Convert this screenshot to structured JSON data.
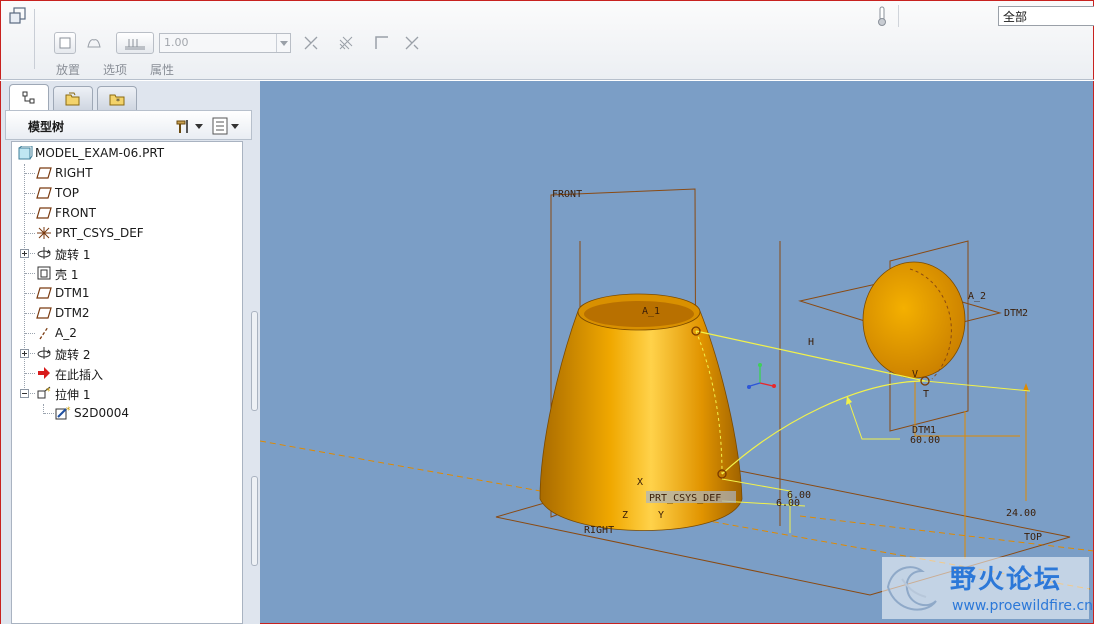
{
  "ribbon": {
    "labels": {
      "placement": "放置",
      "options": "选项",
      "properties": "属性"
    },
    "thickness_value": "1.00",
    "filter_value": "全部"
  },
  "panel": {
    "title": "模型树",
    "tree": [
      {
        "label": "MODEL_EXAM-06.PRT",
        "icon": "part-icon"
      },
      {
        "label": "RIGHT",
        "icon": "datum-plane-icon"
      },
      {
        "label": "TOP",
        "icon": "datum-plane-icon"
      },
      {
        "label": "FRONT",
        "icon": "datum-plane-icon"
      },
      {
        "label": "PRT_CSYS_DEF",
        "icon": "csys-icon"
      },
      {
        "label": "旋转 1",
        "icon": "revolve-icon"
      },
      {
        "label": "壳 1",
        "icon": "shell-icon"
      },
      {
        "label": "DTM1",
        "icon": "datum-plane-icon"
      },
      {
        "label": "DTM2",
        "icon": "datum-plane-icon"
      },
      {
        "label": "A_2",
        "icon": "axis-icon"
      },
      {
        "label": "旋转 2",
        "icon": "revolve-icon"
      },
      {
        "label": "在此插入",
        "icon": "insert-arrow-icon"
      },
      {
        "label": "拉伸 1",
        "icon": "extrude-icon"
      },
      {
        "label": "S2D0004",
        "icon": "sketch-icon"
      }
    ]
  },
  "viewport": {
    "labels": {
      "front": "FRONT",
      "a1": "A_1",
      "a2": "A_2",
      "dtm2": "DTM2",
      "dtm1": "DTM1",
      "h": "H",
      "v": "V",
      "t": "T",
      "prt_csys": "PRT_CSYS_DEF",
      "right": "RIGHT",
      "top": "TOP",
      "dim_60": "60.00",
      "dim_6a": "6.00",
      "dim_6b": "6.00",
      "dim_24": "24.00",
      "x": "X",
      "z": "Z",
      "y": "Y"
    }
  },
  "watermark": {
    "title": "野火论坛",
    "url": "www.proewildfire.cn"
  },
  "colors": {
    "viewport_bg": "#7b9ec6",
    "model": "#e89a00",
    "datum": "#8a4a12",
    "sketch": "#f2f24a"
  }
}
